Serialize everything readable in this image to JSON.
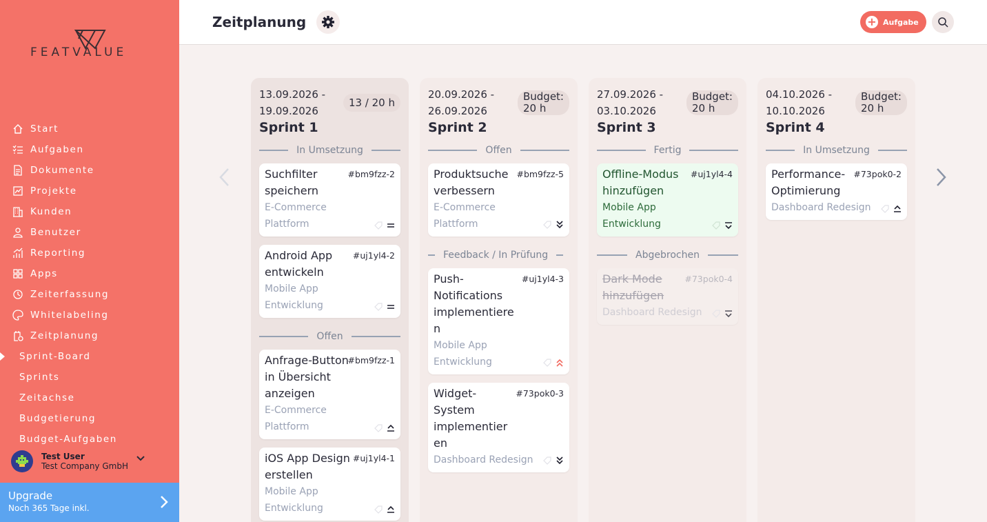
{
  "brand": {
    "name": "FEATVALUE"
  },
  "header": {
    "title": "Zeitplanung",
    "add_label": "Aufgabe"
  },
  "nav": {
    "items": [
      {
        "label": "Start",
        "icon": "home-icon"
      },
      {
        "label": "Aufgaben",
        "icon": "tasks-icon"
      },
      {
        "label": "Dokumente",
        "icon": "document-icon"
      },
      {
        "label": "Projekte",
        "icon": "projects-icon"
      },
      {
        "label": "Kunden",
        "icon": "building-icon"
      },
      {
        "label": "Benutzer",
        "icon": "user-icon"
      },
      {
        "label": "Reporting",
        "icon": "chart-icon"
      },
      {
        "label": "Apps",
        "icon": "apps-icon"
      },
      {
        "label": "Zeiterfassung",
        "icon": "timer-icon"
      },
      {
        "label": "Whitelabeling",
        "icon": "palette-icon"
      },
      {
        "label": "Zeitplanung",
        "icon": "calendar-clock-icon"
      }
    ],
    "sub_items": [
      {
        "label": "Sprint-Board",
        "active": true
      },
      {
        "label": "Sprints"
      },
      {
        "label": "Zeitachse"
      },
      {
        "label": "Budgetierung"
      },
      {
        "label": "Budget-Aufgaben"
      }
    ]
  },
  "user": {
    "name": "Test User",
    "company": "Test Company GmbH"
  },
  "upgrade": {
    "title": "Upgrade",
    "subtitle": "Noch 365 Tage inkl."
  },
  "sprints": [
    {
      "dates": "13.09.2026 - 19.09.2026",
      "name": "Sprint 1",
      "budget": "13 / 20 h",
      "groups": [
        {
          "status": "In Umsetzung",
          "cards": [
            {
              "title": "Suchfilter speichern",
              "id": "#bm9fzz-2",
              "project": "E-Commerce Plattform",
              "priority": "medium"
            },
            {
              "title": "Android App entwickeln",
              "id": "#uj1yl4-2",
              "project": "Mobile App Entwicklung",
              "priority": "medium"
            }
          ]
        },
        {
          "status": "Offen",
          "cards": [
            {
              "title": "Anfrage-Button in Übersicht anzeigen",
              "id": "#bm9fzz-1",
              "project": "E-Commerce Plattform",
              "priority": "high"
            },
            {
              "title": "iOS App Design erstellen",
              "id": "#uj1yl4-1",
              "project": "Mobile App Entwicklung",
              "priority": "high"
            }
          ]
        }
      ]
    },
    {
      "dates": "20.09.2026 - 26.09.2026",
      "name": "Sprint 2",
      "budget_label": "Budget:",
      "budget_value": "20 h",
      "groups": [
        {
          "status": "Offen",
          "cards": [
            {
              "title": "Produktsuche verbessern",
              "id": "#bm9fzz-5",
              "project": "E-Commerce Plattform",
              "priority": "lowest"
            }
          ]
        },
        {
          "status": "Feedback / In Prüfung",
          "cards": [
            {
              "title": "Push-Notifications implementiere n",
              "id": "#uj1yl4-3",
              "project": "Mobile App Entwicklung",
              "priority": "highest"
            },
            {
              "title": "Widget-System implementier en",
              "id": "#73pok0-3",
              "project": "Dashboard Redesign",
              "priority": "lowest"
            }
          ]
        }
      ]
    },
    {
      "dates": "27.09.2026 - 03.10.2026",
      "name": "Sprint 3",
      "budget_label": "Budget:",
      "budget_value": "20 h",
      "groups": [
        {
          "status": "Fertig",
          "cards": [
            {
              "title": "Offline-Modus hinzufügen",
              "id": "#uj1yl4-4",
              "project": "Mobile App Entwicklung",
              "priority": "low"
            }
          ]
        },
        {
          "status": "Abgebrochen",
          "cards": [
            {
              "title": "Dark Mode hinzufügen",
              "id": "#73pok0-4",
              "project": "Dashboard Redesign",
              "priority": "low"
            }
          ]
        }
      ]
    },
    {
      "dates": "04.10.2026 - 10.10.2026",
      "name": "Sprint 4",
      "budget_label": "Budget:",
      "budget_value": "20 h",
      "groups": [
        {
          "status": "In Umsetzung",
          "cards": [
            {
              "title": "Performance-Optimierung",
              "id": "#73pok0-2",
              "project": "Dashboard Redesign",
              "priority": "high"
            }
          ]
        }
      ]
    }
  ],
  "colors": {
    "sidebar": "#f47268",
    "accent": "#f26b61",
    "upgrade": "#5ba4f0",
    "done_card": "#edfbf0"
  }
}
